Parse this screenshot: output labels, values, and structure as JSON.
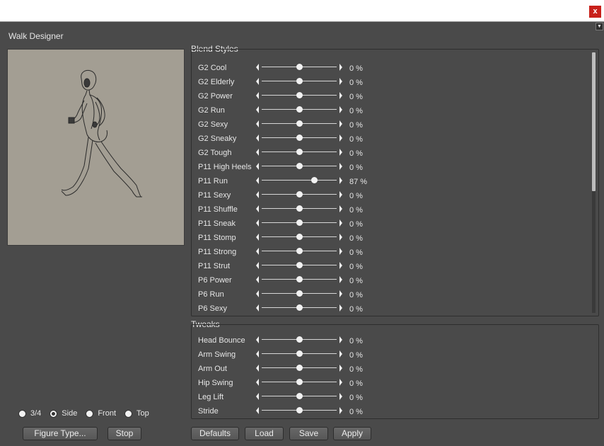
{
  "window": {
    "close_label": "x",
    "menu_arrow": "▼"
  },
  "title": "Walk Designer",
  "blend_styles": {
    "label": "Blend Styles",
    "rows": [
      {
        "label": "G2 Cool",
        "value": "0 %",
        "level": 0.5
      },
      {
        "label": "G2 Elderly",
        "value": "0 %",
        "level": 0.5
      },
      {
        "label": "G2 Power",
        "value": "0 %",
        "level": 0.5
      },
      {
        "label": "G2 Run",
        "value": "0 %",
        "level": 0.5
      },
      {
        "label": "G2 Sexy",
        "value": "0 %",
        "level": 0.5
      },
      {
        "label": "G2 Sneaky",
        "value": "0 %",
        "level": 0.5
      },
      {
        "label": "G2 Tough",
        "value": "0 %",
        "level": 0.5
      },
      {
        "label": "P11 High Heels",
        "value": "0 %",
        "level": 0.5
      },
      {
        "label": "P11 Run",
        "value": "87 %",
        "level": 0.7
      },
      {
        "label": "P11 Sexy",
        "value": "0 %",
        "level": 0.5
      },
      {
        "label": "P11 Shuffle",
        "value": "0 %",
        "level": 0.5
      },
      {
        "label": "P11 Sneak",
        "value": "0 %",
        "level": 0.5
      },
      {
        "label": "P11 Stomp",
        "value": "0 %",
        "level": 0.5
      },
      {
        "label": "P11 Strong",
        "value": "0 %",
        "level": 0.5
      },
      {
        "label": "P11 Strut",
        "value": "0 %",
        "level": 0.5
      },
      {
        "label": "P6 Power",
        "value": "0 %",
        "level": 0.5
      },
      {
        "label": "P6 Run",
        "value": "0 %",
        "level": 0.5
      },
      {
        "label": "P6 Sexy",
        "value": "0 %",
        "level": 0.5
      }
    ]
  },
  "tweaks": {
    "label": "Tweaks",
    "rows": [
      {
        "label": "Head Bounce",
        "value": "0 %",
        "level": 0.5
      },
      {
        "label": "Arm Swing",
        "value": "0 %",
        "level": 0.5
      },
      {
        "label": "Arm Out",
        "value": "0 %",
        "level": 0.5
      },
      {
        "label": "Hip Swing",
        "value": "0 %",
        "level": 0.5
      },
      {
        "label": "Leg Lift",
        "value": "0 %",
        "level": 0.5
      },
      {
        "label": "Stride",
        "value": "0 %",
        "level": 0.5
      }
    ]
  },
  "view_options": [
    {
      "label": "3/4",
      "selected": false
    },
    {
      "label": "Side",
      "selected": true
    },
    {
      "label": "Front",
      "selected": false
    },
    {
      "label": "Top",
      "selected": false
    }
  ],
  "buttons": {
    "figure_type": "Figure Type...",
    "stop": "Stop",
    "defaults": "Defaults",
    "load": "Load",
    "save": "Save",
    "apply": "Apply"
  },
  "colors": {
    "background": "#4a4a4a",
    "preview_background": "#a39e93",
    "close_button": "#c8201a"
  }
}
